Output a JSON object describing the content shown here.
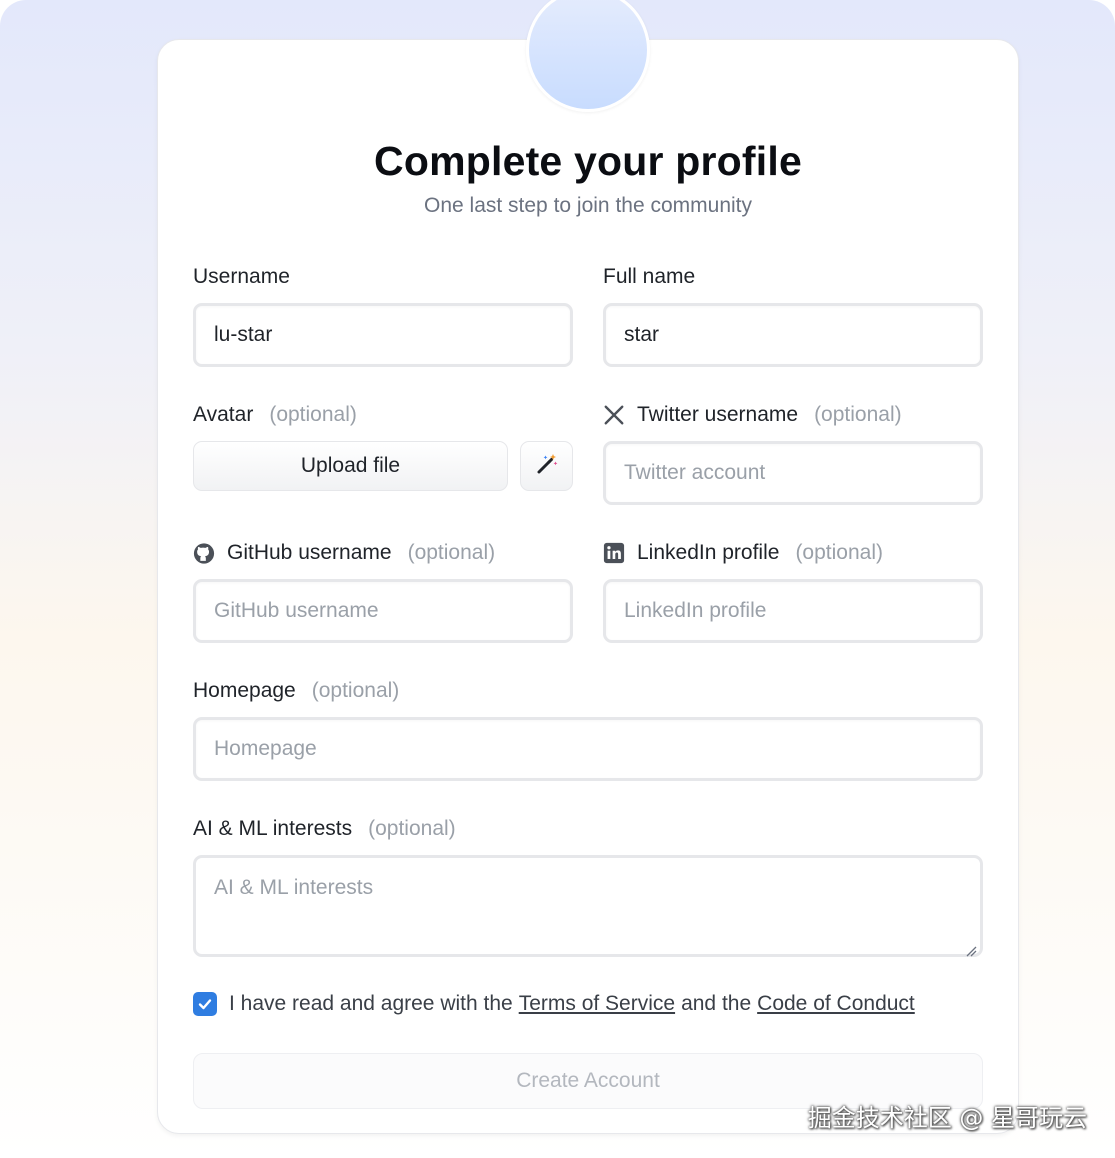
{
  "header": {
    "title": "Complete your profile",
    "subtitle": "One last step to join the community"
  },
  "optional_text": "(optional)",
  "fields": {
    "username": {
      "label": "Username",
      "value": "lu-star"
    },
    "fullname": {
      "label": "Full name",
      "value": "star"
    },
    "avatar": {
      "label": "Avatar",
      "upload_label": "Upload file",
      "magic_icon": "magic-wand-icon"
    },
    "twitter": {
      "label": "Twitter username",
      "placeholder": "Twitter account",
      "icon": "x-logo-icon"
    },
    "github": {
      "label": "GitHub username",
      "placeholder": "GitHub username",
      "icon": "github-icon"
    },
    "linkedin": {
      "label": "LinkedIn profile",
      "placeholder": "LinkedIn profile",
      "icon": "linkedin-icon"
    },
    "homepage": {
      "label": "Homepage",
      "placeholder": "Homepage"
    },
    "interests": {
      "label": "AI & ML interests",
      "placeholder": "AI & ML interests"
    }
  },
  "agreement": {
    "checked": true,
    "prefix": "I have read and agree with the",
    "terms": "Terms of Service",
    "middle": "and the",
    "conduct": "Code of Conduct"
  },
  "submit_label": "Create Account",
  "watermark": "掘金技术社区 @ 星哥玩云",
  "colors": {
    "accent": "#2f7de1",
    "muted": "#9aa0a8"
  }
}
